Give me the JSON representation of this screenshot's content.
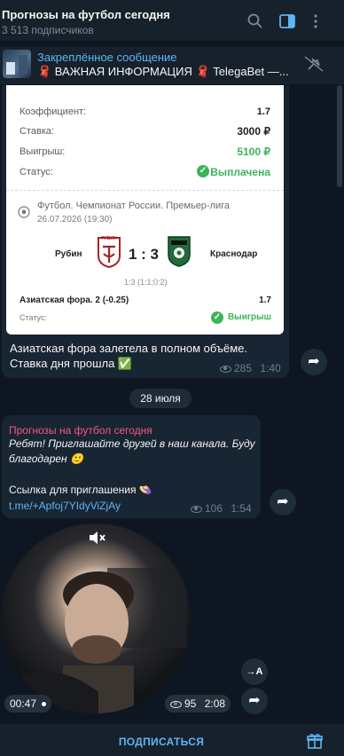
{
  "header": {
    "title": "Прогнозы на футбол сегодня",
    "subscribers": "3 513 подписчиков"
  },
  "pinned": {
    "title": "Закреплённое сообщение",
    "text": "🧣 ВАЖНАЯ ИНФОРМАЦИЯ 🧣 TelegaBet —..."
  },
  "bet_card": {
    "coefficient_label": "Коэффициент:",
    "coefficient_value": "1.7",
    "stake_label": "Ставка:",
    "stake_value": "3000 ₽",
    "win_label": "Выигрыш:",
    "win_value": "5100 ₽",
    "status_label": "Статус:",
    "status_value": "Выплачена",
    "league": "Футбол. Чемпионат России. Премьер-лига",
    "datetime": "26.07.2026 (19:30)",
    "home_team": "Рубин",
    "home_logo_text": "РУБИН",
    "score": "1 : 3",
    "away_team": "Краснодар",
    "half_scores": "1:3 (1:1;0:2)",
    "market": "Азиатская фора. 2 (-0.25)",
    "market_odds": "1.7",
    "market_status_label": "Статус:",
    "market_status_value": "Выигрыш"
  },
  "message1": {
    "text": "Азиатская фора залетела в полном объёме. Ставка дня прошла ✅",
    "views": "285",
    "time": "1:40"
  },
  "date_separator": "28 июля",
  "message2": {
    "author": "Прогнозы на футбол сегодня",
    "text": "Ребят! Приглашайте друзей в наш канала. Буду благодарен 🙂",
    "invite_label": "Ссылка для приглашения 👒",
    "link": "t.me/+Apfoj7YIdyViZjAy",
    "views": "106",
    "time": "1:54"
  },
  "video_message": {
    "duration": "00:47",
    "views": "95",
    "time": "2:08",
    "translate_label": "→A"
  },
  "footer": {
    "subscribe_label": "ПОДПИСАТЬСЯ"
  },
  "colors": {
    "background": "#0e1621",
    "panel": "#17212b",
    "bubble": "#182533",
    "accent": "#5eb5f7",
    "success": "#3cb45a",
    "author": "#f5577f"
  }
}
